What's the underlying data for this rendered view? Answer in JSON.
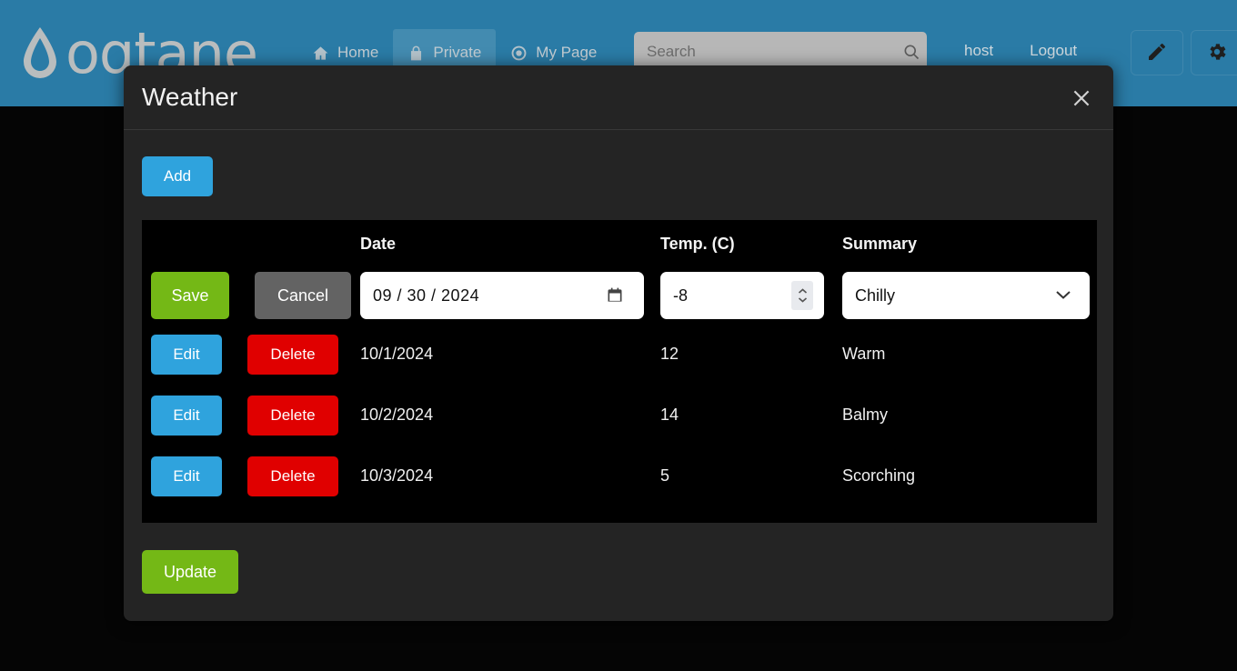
{
  "header": {
    "brand": "oqtane",
    "brand_icon": "water-drop-logo",
    "nav": [
      {
        "label": "Home",
        "icon": "home-icon",
        "active": false
      },
      {
        "label": "Private",
        "icon": "lock-icon",
        "active": true
      },
      {
        "label": "My Page",
        "icon": "target-icon",
        "active": false
      }
    ],
    "search": {
      "placeholder": "Search",
      "value": "",
      "icon": "search-icon"
    },
    "user": "host",
    "logout": "Logout",
    "edit_button_icon": "pencil-icon",
    "settings_button_icon": "gear-icon",
    "background_color": "#2a7ba6"
  },
  "modal": {
    "title": "Weather",
    "close_icon": "close-icon",
    "add_label": "Add",
    "update_label": "Update",
    "accent_blue": "#2fa3dd",
    "accent_green": "#74b816",
    "accent_red": "#e00000",
    "accent_gray": "#636363",
    "table": {
      "columns": [
        "",
        "Date",
        "Temp. (C)",
        "Summary"
      ],
      "edit_row": {
        "save_label": "Save",
        "cancel_label": "Cancel",
        "date_value": "09 / 30 / 2024",
        "date_icon": "calendar-icon",
        "temp_value": "-8",
        "spinner_icon": "spinner-updown-icon",
        "summary_value": "Chilly",
        "summary_icon": "chevron-down-icon"
      },
      "rows": [
        {
          "edit_label": "Edit",
          "delete_label": "Delete",
          "date": "10/1/2024",
          "temp": "12",
          "summary": "Warm"
        },
        {
          "edit_label": "Edit",
          "delete_label": "Delete",
          "date": "10/2/2024",
          "temp": "14",
          "summary": "Balmy"
        },
        {
          "edit_label": "Edit",
          "delete_label": "Delete",
          "date": "10/3/2024",
          "temp": "5",
          "summary": "Scorching"
        }
      ]
    }
  }
}
